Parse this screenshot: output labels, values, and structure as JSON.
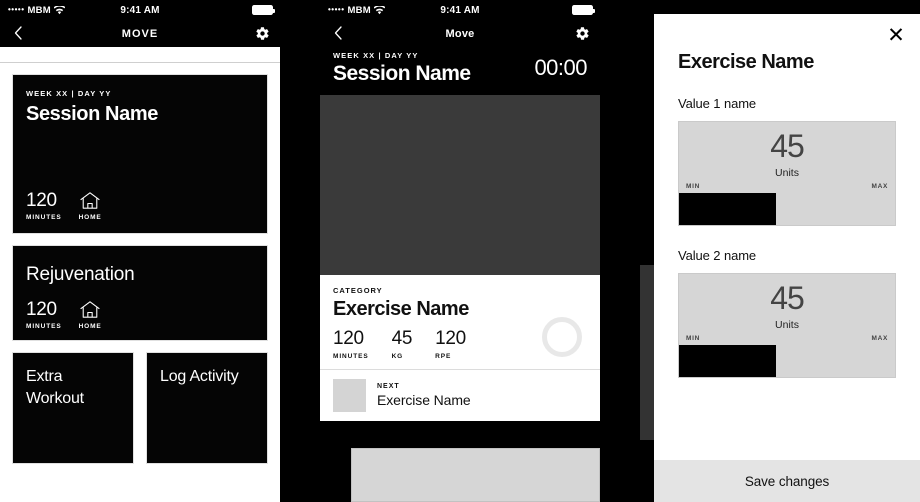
{
  "status_bar": {
    "signal_dots": "•••••",
    "carrier": "MBM",
    "time": "9:41 AM"
  },
  "panel1": {
    "nav": {
      "title": "MOVE",
      "back_icon": "chevron-left-icon",
      "settings_icon": "gear-icon"
    },
    "session_card": {
      "eyebrow": "WEEK XX | DAY YY",
      "title": "Session Name",
      "metrics": [
        {
          "value": "120",
          "label": "MINUTES"
        },
        {
          "icon": "home-icon",
          "label": "HOME"
        }
      ]
    },
    "rejuvenation_card": {
      "title": "Rejuvenation",
      "metrics": [
        {
          "value": "120",
          "label": "MINUTES"
        },
        {
          "icon": "home-icon",
          "label": "HOME"
        }
      ]
    },
    "action_cards": [
      {
        "title": "Extra Workout"
      },
      {
        "title": "Log Activity"
      }
    ]
  },
  "panel2": {
    "nav": {
      "title": "Move",
      "back_icon": "chevron-left-icon",
      "settings_icon": "gear-icon"
    },
    "header": {
      "eyebrow": "WEEK XX | DAY YY",
      "title": "Session Name",
      "timer": "00:00"
    },
    "exercise": {
      "category": "CATEGORY",
      "name": "Exercise Name",
      "metrics": [
        {
          "value": "120",
          "label": "MINUTES"
        },
        {
          "value": "45",
          "label": "KG"
        },
        {
          "value": "120",
          "label": "RPE"
        }
      ],
      "progress_ring": "progress-ring-icon"
    },
    "next": {
      "eyebrow": "NEXT",
      "name": "Exercise Name"
    }
  },
  "panel3": {
    "close_icon": "✕",
    "title": "Exercise Name",
    "fields": [
      {
        "label": "Value 1 name",
        "value": "45",
        "units": "Units",
        "min_label": "MIN",
        "max_label": "MAX",
        "fill_percent": "45%"
      },
      {
        "label": "Value 2 name",
        "value": "45",
        "units": "Units",
        "min_label": "MIN",
        "max_label": "MAX",
        "fill_percent": "45%"
      }
    ],
    "save_label": "Save changes"
  }
}
